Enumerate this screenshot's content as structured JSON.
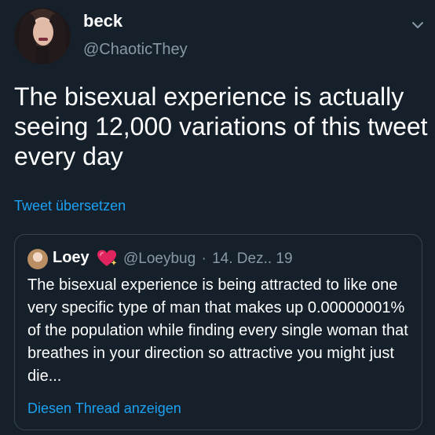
{
  "tweet": {
    "author_name": "beck",
    "author_handle": "@ChaoticThey",
    "text": "The bisexual experience is actually seeing 12,000 variations of this tweet every day",
    "translate_label": "Tweet übersetzen",
    "menu_icon": "chevron-down-icon"
  },
  "quoted": {
    "author_name": "Loey",
    "author_badge_icon": "sparkling-heart-icon",
    "author_handle": "@Loeybug",
    "separator": "·",
    "date": "14. Dez.. 19",
    "text": "The bisexual experience is being attracted to like one very specific type of man that makes up 0.00000001% of the population while finding every single woman that breathes in your direction so attractive you might just die...",
    "thread_label": "Diesen Thread anzeigen"
  },
  "colors": {
    "background": "#15202b",
    "text": "#ffffff",
    "muted": "#8899a6",
    "link": "#1da1f2",
    "border": "#38444d"
  }
}
